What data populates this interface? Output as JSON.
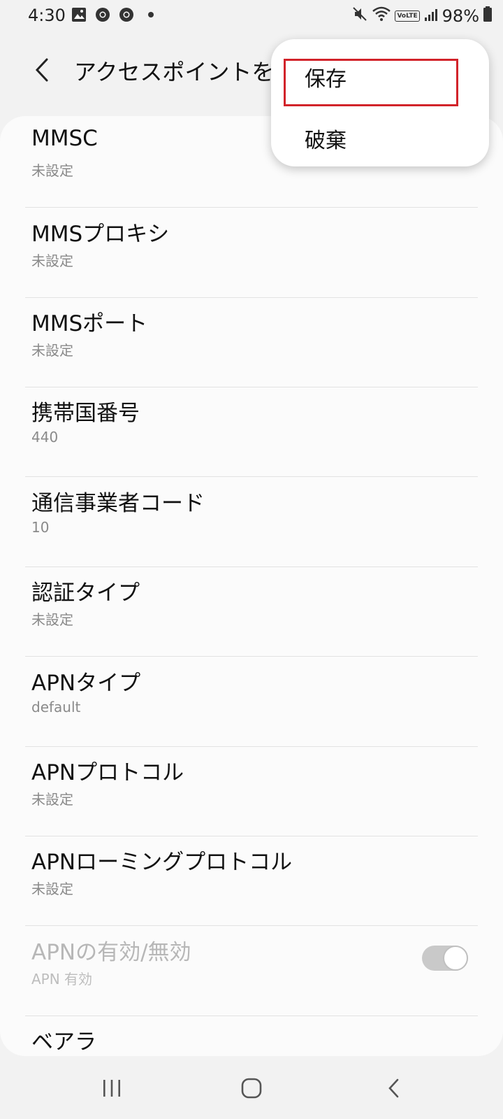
{
  "status_bar": {
    "time": "4:30",
    "battery": "98%",
    "volte": "VoLTE",
    "left_icons": [
      "gallery-icon",
      "chrome-icon",
      "chrome-icon",
      "notification-dot"
    ],
    "right_icons": [
      "mute-icon",
      "wifi-icon",
      "volte-icon",
      "signal-icon",
      "battery-icon"
    ]
  },
  "app_bar": {
    "title": "アクセスポイントを"
  },
  "menu": {
    "items": [
      {
        "label": "保存"
      },
      {
        "label": "破棄"
      }
    ],
    "highlight_color": "#d2232a"
  },
  "settings": {
    "items": [
      {
        "title": "MMSC",
        "value": "未設定"
      },
      {
        "title": "MMSプロキシ",
        "value": "未設定"
      },
      {
        "title": "MMSポート",
        "value": "未設定"
      },
      {
        "title": "携帯国番号",
        "value": "440"
      },
      {
        "title": "通信事業者コード",
        "value": "10"
      },
      {
        "title": "認証タイプ",
        "value": "未設定"
      },
      {
        "title": "APNタイプ",
        "value": "default"
      },
      {
        "title": "APNプロトコル",
        "value": "未設定"
      },
      {
        "title": "APNローミングプロトコル",
        "value": "未設定"
      },
      {
        "title": "APNの有効/無効",
        "value": "APN 有効",
        "toggle_on": true,
        "disabled": true
      },
      {
        "title": "ベアラ",
        "value": ""
      }
    ]
  },
  "nav_bar": {
    "buttons": [
      "recents-icon",
      "home-icon",
      "back-icon"
    ]
  }
}
